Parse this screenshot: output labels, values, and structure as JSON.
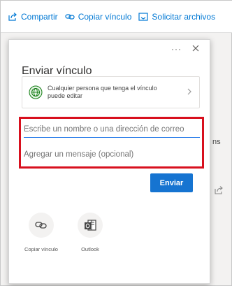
{
  "toolbar": {
    "share_label": "Compartir",
    "copy_link_label": "Copiar vínculo",
    "request_files_label": "Solicitar archivos"
  },
  "background": {
    "partial_text": "ns"
  },
  "dialog": {
    "title": "Enviar vínculo",
    "more_label": "···",
    "permission_text": "Cualquier persona que tenga el vínculo puede editar",
    "to_placeholder": "Escribe un nombre o una dirección de correo",
    "message_placeholder": "Agregar un mensaje (opcional)",
    "send_label": "Enviar",
    "actions": [
      {
        "label": "Copiar vínculo",
        "icon": "link-icon"
      },
      {
        "label": "Outlook",
        "icon": "outlook-icon"
      }
    ]
  },
  "colors": {
    "accent": "#0078d4",
    "send_button": "#1674d1",
    "highlight_border": "#d8101e",
    "globe_icon": "#107c10"
  }
}
